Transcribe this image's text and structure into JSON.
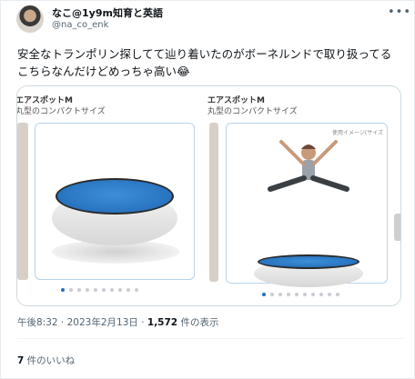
{
  "author": {
    "display_name": "なこ@1y9m知育と英語",
    "handle": "@na_co_enk",
    "avatar_icon": "avatar-photo"
  },
  "more_icon": "more-horizontal-icon",
  "tweet": {
    "line1": "安全なトランポリン探してて辿り着いたのがボーネルンドで取り扱ってる",
    "line2": "こちらなんだけどめっちゃ高い😂"
  },
  "media": {
    "slides": [
      {
        "title": "エアスポットM",
        "subtitle": "丸型のコンパクトサイズ",
        "dots": 10,
        "active_dot": 0
      },
      {
        "title": "エアスポットM",
        "subtitle": "丸型のコンパクトサイズ",
        "usage_label": "使用イメージ(サイズ",
        "dots": 10,
        "active_dot": 0
      }
    ],
    "colors": {
      "trampoline_top": "#1f67b4",
      "dot_active": "#1d6fc9",
      "thumb_border": "#b9d3ea"
    }
  },
  "meta": {
    "time": "午後8:32",
    "separator": " · ",
    "date": "2023年2月13日",
    "views_count": "1,572",
    "views_label": " 件の表示"
  },
  "likes": {
    "count": "7",
    "label": " 件のいいね"
  }
}
